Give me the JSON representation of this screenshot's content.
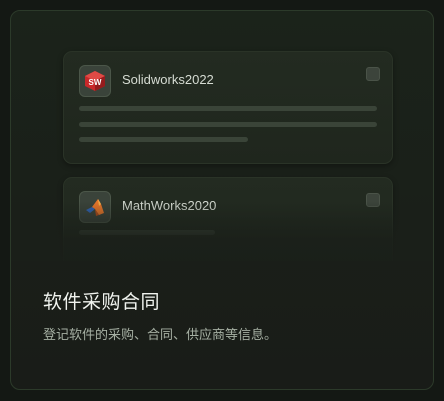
{
  "card": {
    "title": "软件采购合同",
    "description": "登记软件的采购、合同、供应商等信息。"
  },
  "preview": {
    "items": [
      {
        "name": "Solidworks2022",
        "icon": "solidworks-logo-icon"
      },
      {
        "name": "MathWorks2020",
        "icon": "matlab-logo-icon"
      }
    ]
  },
  "colors": {
    "background": "#141814",
    "card": "#1a1f19",
    "card_border": "#2c3a2a",
    "solidworks_red": "#c8282a",
    "matlab_orange": "#e8762b",
    "matlab_blue": "#2f63b5"
  }
}
